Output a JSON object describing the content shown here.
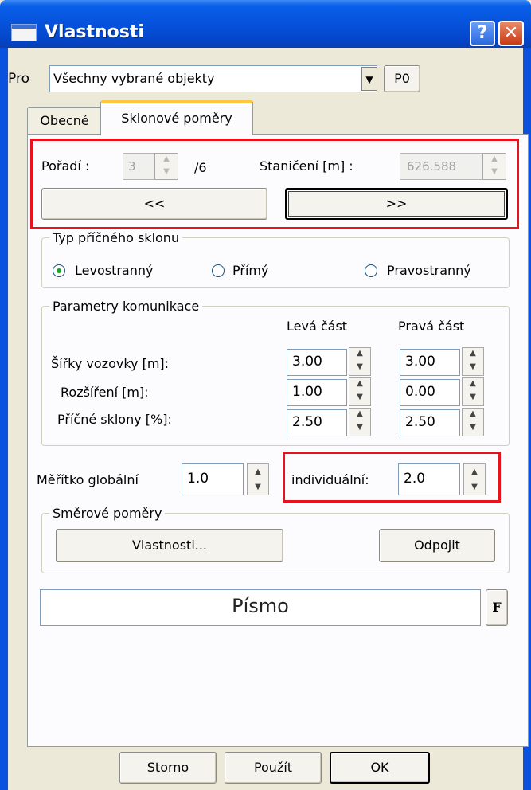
{
  "window": {
    "title": "Vlastnosti",
    "help_glyph": "?",
    "close_glyph": "✕"
  },
  "pro": {
    "label": "Pro",
    "value": "Všechny vybrané objekty",
    "dropdown_glyph": "▼",
    "p0_label": "P0"
  },
  "tabs": [
    {
      "label": "Obecné"
    },
    {
      "label": "Sklonové poměry"
    }
  ],
  "order": {
    "label": "Pořadí :",
    "value": "3",
    "total": "/6"
  },
  "station": {
    "label": "Staničení [m] :",
    "value": "626.588"
  },
  "nav": {
    "prev_label": "<<",
    "next_label": ">>"
  },
  "cross_slope": {
    "legend": "Typ příčného sklonu",
    "options": [
      {
        "label": "Levostranný"
      },
      {
        "label": "Přímý"
      },
      {
        "label": "Pravostranný"
      }
    ],
    "selected": "Levostranný"
  },
  "road": {
    "legend": "Parametry komunikace",
    "col_left": "Levá část",
    "col_right": "Pravá část",
    "rows": [
      {
        "label": "Šířky vozovky [m]:",
        "left": "3.00",
        "right": "3.00"
      },
      {
        "label": "Rozšíření [m]:",
        "left": "1.00",
        "right": "0.00"
      },
      {
        "label": "Příčné sklony [%]:",
        "left": "2.50",
        "right": "2.50"
      }
    ]
  },
  "scale": {
    "global_label": "Měřítko globální",
    "global_value": "1.0",
    "individual_label": "individuální:",
    "individual_value": "2.0"
  },
  "direction": {
    "legend": "Směrové poměry",
    "properties_label": "Vlastnosti...",
    "detach_label": "Odpojit"
  },
  "font": {
    "label": "Písmo",
    "button_glyph": "F"
  },
  "footer": {
    "cancel_label": "Storno",
    "apply_label": "Použít",
    "ok_label": "OK"
  },
  "colors": {
    "titlebar": "#0a52dd",
    "highlight_red": "#e8121f",
    "face": "#ece9d8"
  }
}
